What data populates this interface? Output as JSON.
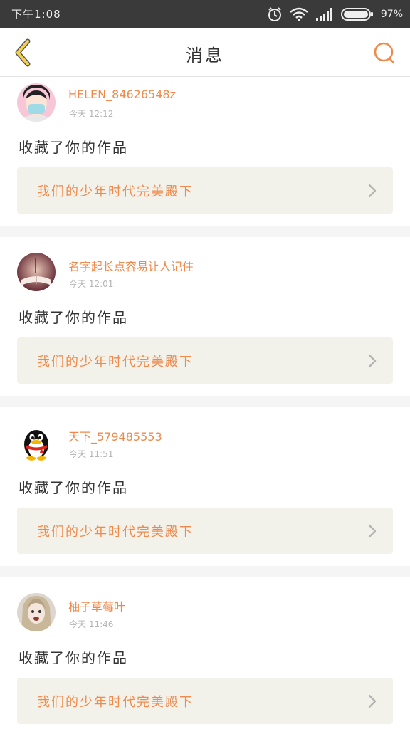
{
  "status_bar": {
    "time": "下午1:08",
    "battery": "97%",
    "icons": [
      "alarm-icon",
      "wifi-icon",
      "signal-icon",
      "battery-icon"
    ]
  },
  "header": {
    "title": "消息",
    "back_icon": "chevron-left-icon",
    "search_icon": "search-icon"
  },
  "colors": {
    "accent": "#F08A4B",
    "back_icon": "#F2C94C",
    "card_bg": "#F2F2EA",
    "separator": "#F5F5F5",
    "status_bar": "#3A3A3A"
  },
  "messages": [
    {
      "username": "HELEN_84626548z",
      "time": "今天 12:12",
      "action": "收藏了你的作品",
      "work_title": "我们的少年时代完美殿下",
      "avatar": "person-with-mask-avatar"
    },
    {
      "username": "名字起长点容易让人记住",
      "time": "今天 12:01",
      "action": "收藏了你的作品",
      "work_title": "我们的少年时代完美殿下",
      "avatar": "book-photo-avatar"
    },
    {
      "username": "天下_579485553",
      "time": "今天 11:51",
      "action": "收藏了你的作品",
      "work_title": "我们的少年时代完美殿下",
      "avatar": "penguin-avatar"
    },
    {
      "username": "柚子草莓叶",
      "time": "今天 11:46",
      "action": "收藏了你的作品",
      "work_title": "我们的少年时代完美殿下",
      "avatar": "girl-portrait-avatar"
    }
  ]
}
